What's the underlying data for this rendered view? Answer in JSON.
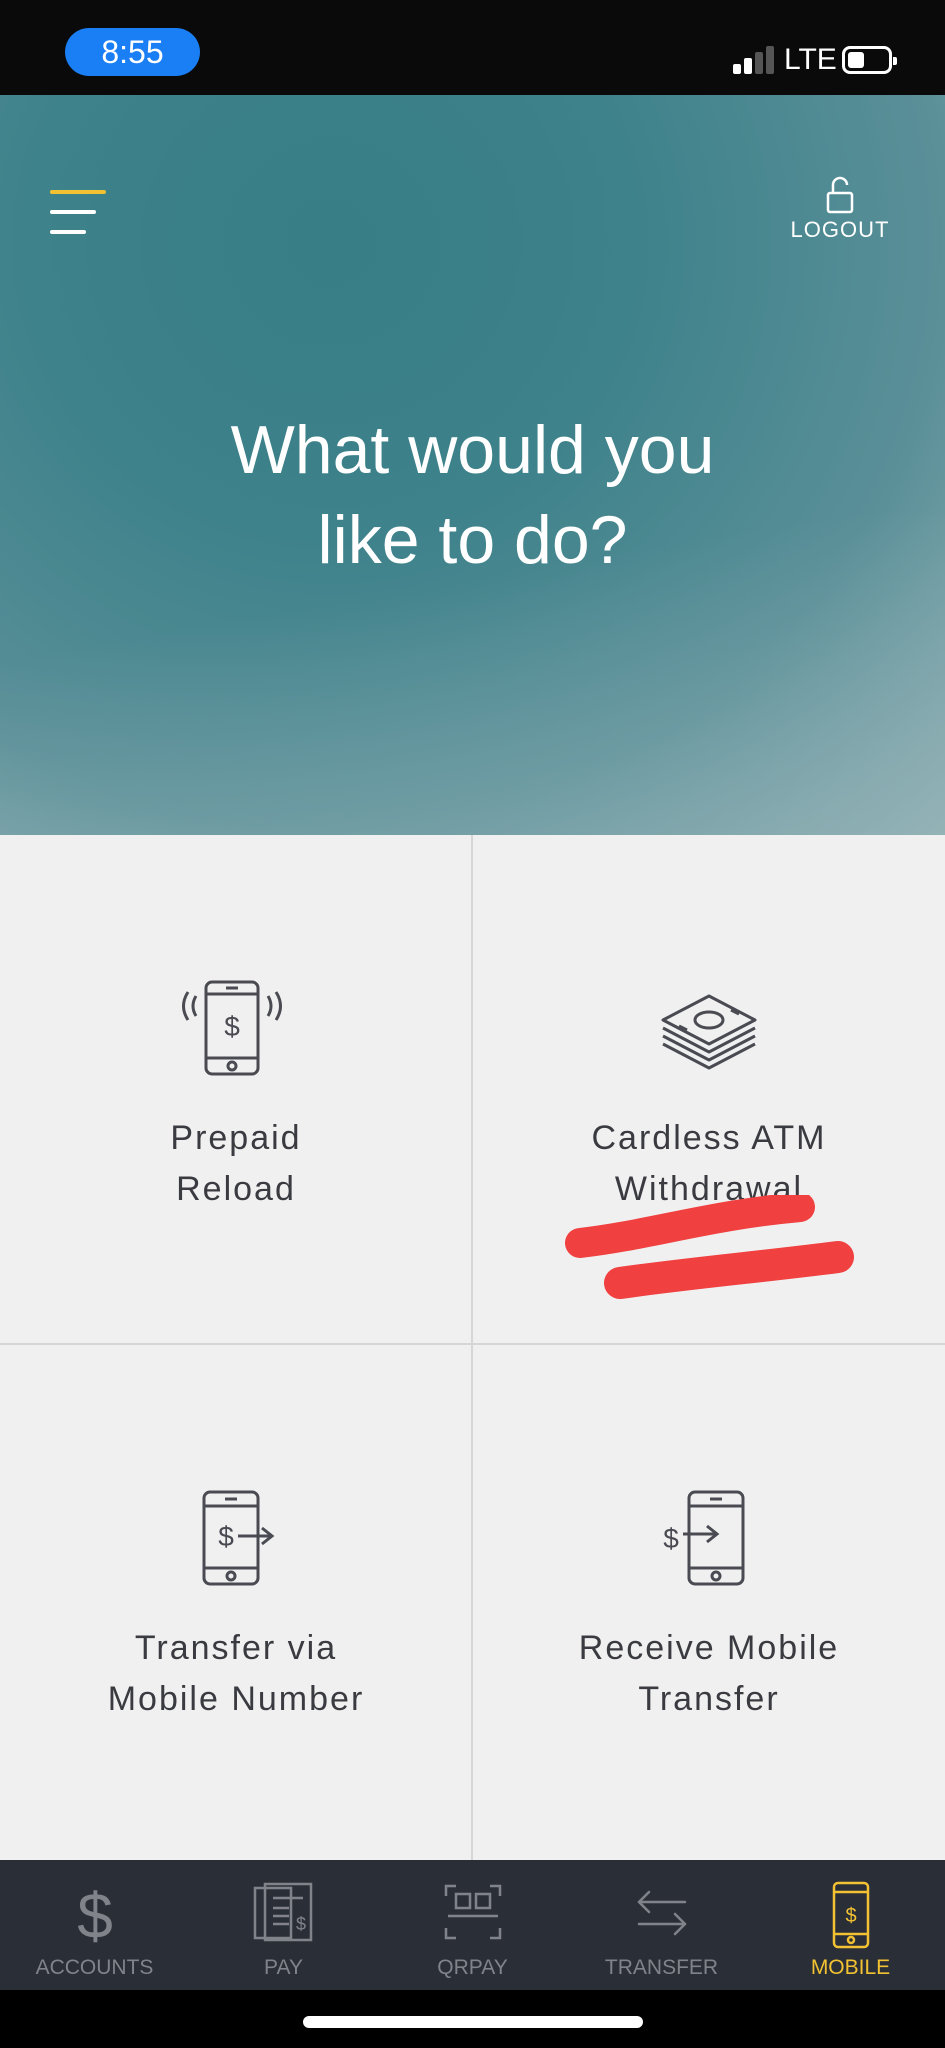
{
  "status_bar": {
    "time": "8:55",
    "network": "LTE",
    "signal_bars_active": 2,
    "signal_bars_total": 4,
    "battery_level": 0.3
  },
  "header": {
    "menu_icon": "menu-icon",
    "logout_icon": "unlocked-padlock-icon",
    "logout_label": "LOGOUT"
  },
  "hero": {
    "title": "What would you\nlike to do?"
  },
  "actions": [
    {
      "label": "Prepaid\nReload",
      "icon": "phone-dollar-vibrate-icon"
    },
    {
      "label": "Cardless ATM\nWithdrawal",
      "icon": "cash-stack-icon"
    },
    {
      "label": "Transfer via\nMobile Number",
      "icon": "phone-send-money-icon"
    },
    {
      "label": "Receive Mobile\nTransfer",
      "icon": "phone-receive-money-icon"
    }
  ],
  "bottom_nav": [
    {
      "label": "ACCOUNTS",
      "icon": "dollar-icon",
      "active": false
    },
    {
      "label": "PAY",
      "icon": "bill-icon",
      "active": false
    },
    {
      "label": "QRPAY",
      "icon": "qr-scan-icon",
      "active": false
    },
    {
      "label": "TRANSFER",
      "icon": "transfer-arrows-icon",
      "active": false
    },
    {
      "label": "MOBILE",
      "icon": "mobile-dollar-icon",
      "active": true
    }
  ],
  "colors": {
    "accent_yellow": "#f2c232",
    "status_pill_blue": "#1a7ef5",
    "nav_background": "#2a2e37",
    "grid_background": "#f1f0f1",
    "text_dark": "#3a3b40",
    "nav_inactive": "#80838a",
    "scribble_red": "#f0403f"
  }
}
